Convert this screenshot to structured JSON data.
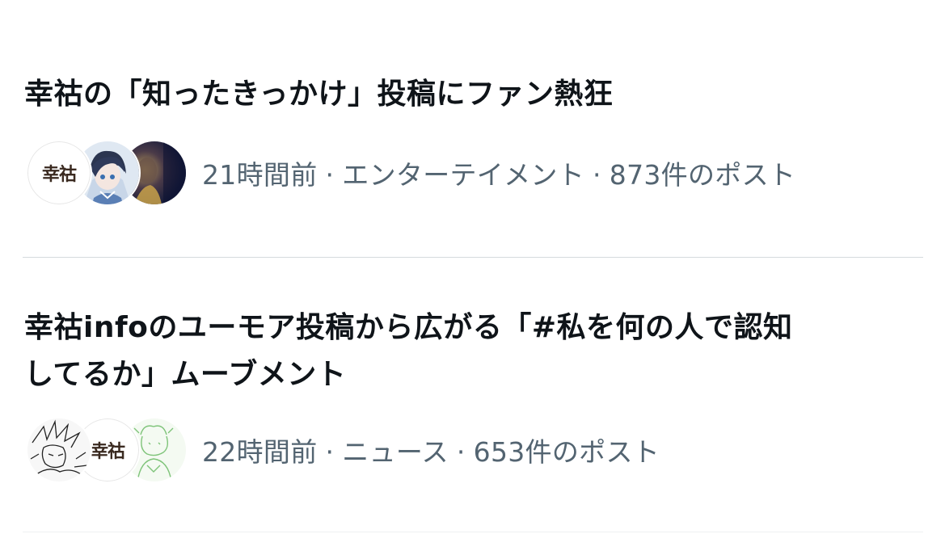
{
  "trends": [
    {
      "headline_lines": [
        "幸祜の「知ったきっかけ」投稿にファン熱狂"
      ],
      "time": "21時間前",
      "category": "エンターテイメント",
      "posts": "873件のポスト",
      "separator": "·",
      "avatars": [
        {
          "kind": "logo",
          "text": "幸祜",
          "icon": "kouko-logo-avatar"
        },
        {
          "kind": "illustration",
          "icon": "anime-character-avatar"
        },
        {
          "kind": "photo",
          "icon": "dark-portrait-avatar"
        }
      ]
    },
    {
      "headline_lines": [
        "幸祜infoのユーモア投稿から広がる「#私を何の人で認知",
        "してるか」ムーブメント"
      ],
      "time": "22時間前",
      "category": "ニュース",
      "posts": "653件のポスト",
      "separator": "·",
      "avatars": [
        {
          "kind": "sketch",
          "icon": "manga-sketch-avatar"
        },
        {
          "kind": "logo",
          "text": "幸祜",
          "icon": "kouko-logo-avatar"
        },
        {
          "kind": "illustration",
          "icon": "green-lineart-avatar"
        }
      ]
    }
  ],
  "colors": {
    "headline": "#0f1419",
    "meta": "#536471",
    "divider": "#d5dadd",
    "background": "#ffffff"
  }
}
